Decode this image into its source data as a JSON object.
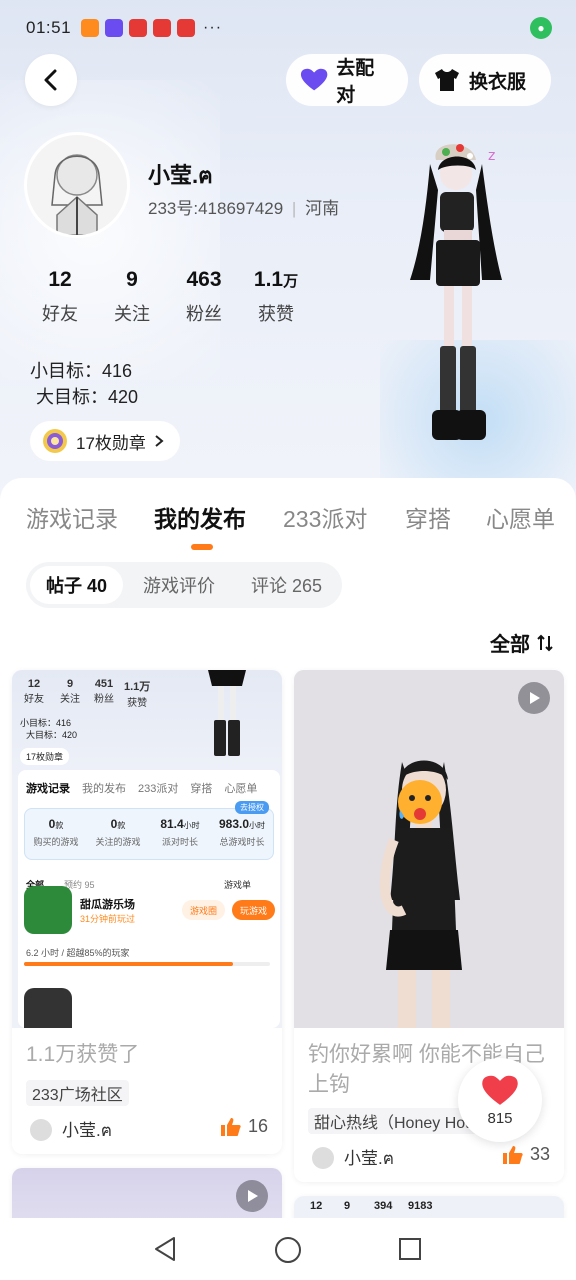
{
  "status_bar": {
    "time": "01:51",
    "more": "···"
  },
  "header": {
    "pair_label": "去配对",
    "dress_label": "换衣服"
  },
  "profile": {
    "name": "小莹.ฅ",
    "id_text": "233号:418697429",
    "location": "河南",
    "stats": [
      {
        "num": "12",
        "unit": "",
        "label": "好友"
      },
      {
        "num": "9",
        "unit": "",
        "label": "关注"
      },
      {
        "num": "463",
        "unit": "",
        "label": "粉丝"
      },
      {
        "num": "1.1",
        "unit": "万",
        "label": "获赞"
      }
    ],
    "small_goal": "小目标：416",
    "big_goal": "大目标：420",
    "medal": "17枚勋章"
  },
  "tabs": [
    "游戏记录",
    "我的发布",
    "233派对",
    "穿搭",
    "心愿单"
  ],
  "subtabs": [
    "帖子 40",
    "游戏评价",
    "评论 265"
  ],
  "filter_label": "全部",
  "post_left": {
    "mini": {
      "stats": [
        {
          "num": "12",
          "label": "好友"
        },
        {
          "num": "9",
          "label": "关注"
        },
        {
          "num": "451",
          "label": "粉丝"
        },
        {
          "num": "1.1万",
          "label": "获赞"
        }
      ],
      "small_goal": "小目标：416",
      "big_goal": "大目标：420",
      "medal": "17枚勋章",
      "tabs": [
        "游戏记录",
        "我的发布",
        "233派对",
        "穿搭",
        "心愿单"
      ],
      "auth": "去授权",
      "cells": [
        {
          "num": "0",
          "unit": "款",
          "label": "购买的游戏"
        },
        {
          "num": "0",
          "unit": "款",
          "label": "关注的游戏"
        },
        {
          "num": "81.4",
          "unit": "小时",
          "label": "派对时长"
        },
        {
          "num": "983.0",
          "unit": "小时",
          "label": "总游戏时长"
        }
      ],
      "filter_all": "全部",
      "filter_reserve": "预约 95",
      "game_list": "游戏单",
      "game_title": "甜瓜游乐场",
      "game_sub": "31分钟前玩过",
      "chip_circle": "游戏圈",
      "chip_play": "玩游戏",
      "play_stat": "6.2 小时 / 超越85%的玩家",
      "progress": 0.85
    },
    "title": "1.1万获赞了",
    "tag": "233广场社区",
    "author": "小莹.ฅ",
    "likes": "16"
  },
  "post_right": {
    "title": "钓你好累啊 你能不能自己上钩",
    "tag": "甜心热线（Honey Hotl...",
    "author": "小莹.ฅ",
    "likes": "33"
  },
  "post_right2_mini": [
    "12",
    "9",
    "394",
    "9183"
  ],
  "float_like_count": "815",
  "colors": {
    "accent": "#ff7a18",
    "pair_heart": "#6b4cf0",
    "like": "#f25a3c"
  }
}
